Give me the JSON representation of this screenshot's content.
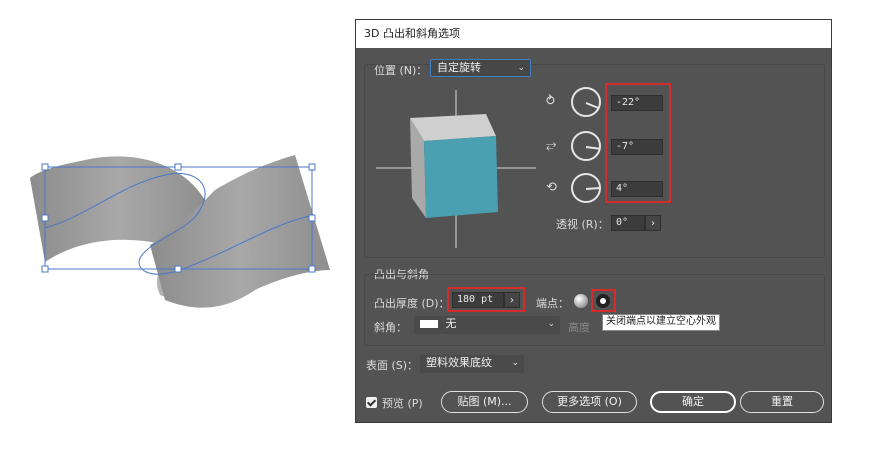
{
  "dialog": {
    "title": "3D 凸出和斜角选项",
    "position_label": "位置 (N)：",
    "position_value": "自定旋转",
    "rotation": {
      "x": "-22°",
      "y": "-7°",
      "z": "4°"
    },
    "rotation_degrees": {
      "x": -22,
      "y": -7,
      "z": 4
    },
    "perspective_label": "透视 (R)：",
    "perspective_value": "0°",
    "extrude_section_label": "凸出与斜角",
    "extrude_depth_label": "凸出厚度 (D)：",
    "extrude_depth_value": "180 pt",
    "cap_label": "端点：",
    "cap_tooltip": "关闭端点以建立空心外观",
    "bevel_label": "斜角：",
    "bevel_value": "无",
    "height_label": "高度",
    "surface_label": "表面 (S)：",
    "surface_value": "塑料效果底纹",
    "preview_label": "预览 (P)",
    "map_button": "贴图 (M)...",
    "more_options_button": "更多选项 (O)",
    "ok_button": "确定",
    "reset_button": "重置"
  },
  "colors": {
    "dialog_bg": "#535353",
    "cube_front": "#4aa0b0",
    "highlight": "#d42b2b",
    "ribbon": "#9a9a9a",
    "selection": "#4a78c8"
  },
  "icons": [
    "x-axis-rotate-icon",
    "y-axis-rotate-icon",
    "z-axis-rotate-icon",
    "chevron-down-icon",
    "arrow-right-icon",
    "cap-on-icon",
    "cap-off-icon",
    "checkbox-checked-icon"
  ]
}
